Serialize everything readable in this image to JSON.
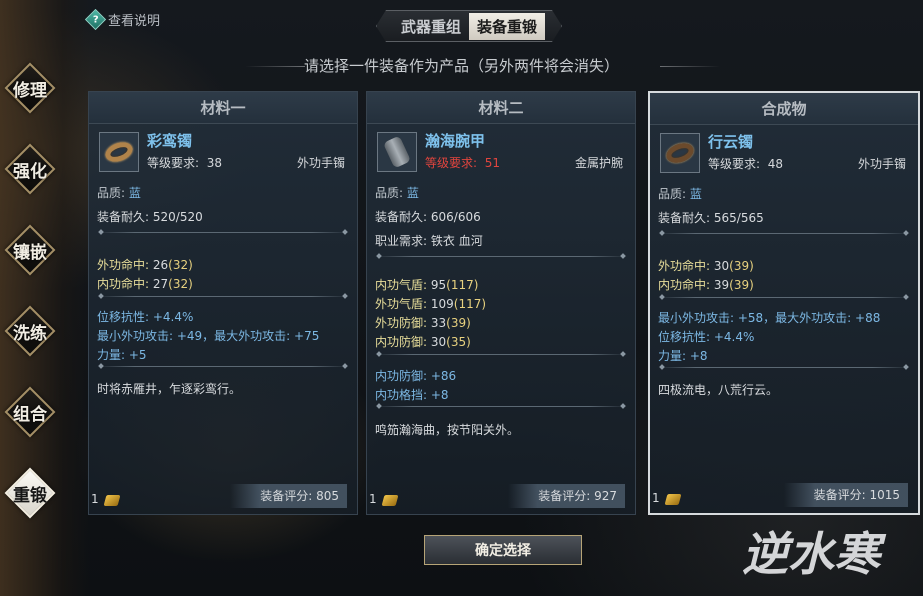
{
  "help": {
    "label": "查看说明",
    "icon": "help-diamond-icon"
  },
  "tabs": [
    {
      "label": "武器重组",
      "active": false
    },
    {
      "label": "装备重锻",
      "active": true
    }
  ],
  "subtitle": "请选择一件装备作为产品（另外两件将会消失）",
  "side_nav": [
    {
      "label": "修理",
      "active": false
    },
    {
      "label": "强化",
      "active": false
    },
    {
      "label": "镶嵌",
      "active": false
    },
    {
      "label": "洗练",
      "active": false
    },
    {
      "label": "组合",
      "active": false
    },
    {
      "label": "重锻",
      "active": true
    }
  ],
  "panels": [
    {
      "header": "材料一",
      "name": "彩鸾镯",
      "level_label": "等级要求:",
      "level": "38",
      "type": "外功手镯",
      "quality_label": "品质:",
      "quality": "蓝",
      "durability_label": "装备耐久:",
      "durability": "520/520",
      "hit_ext_label": "外功命中:",
      "hit_ext": "26",
      "hit_ext_max": "(32)",
      "hit_int_label": "内功命中:",
      "hit_int": "27",
      "hit_int_max": "(32)",
      "bonus": [
        "位移抗性: +4.4%",
        "最小外功攻击: +49，最大外功攻击: +75",
        "力量: +5"
      ],
      "desc": "时将赤雁井，乍逐彩鸾行。",
      "count": "1",
      "score_label": "装备评分:",
      "score": "805"
    },
    {
      "header": "材料二",
      "name": "瀚海腕甲",
      "level_label": "等级要求:",
      "level": "51",
      "type": "金属护腕",
      "quality_label": "品质:",
      "quality": "蓝",
      "durability_label": "装备耐久:",
      "durability": "606/606",
      "req_label": "职业需求:",
      "req": "铁衣 血河",
      "stats": [
        {
          "label": "内功气盾:",
          "val": "95",
          "max": "(117)"
        },
        {
          "label": "外功气盾:",
          "val": "109",
          "max": "(117)"
        },
        {
          "label": "外功防御:",
          "val": "33",
          "max": "(39)"
        },
        {
          "label": "内功防御:",
          "val": "30",
          "max": "(35)"
        }
      ],
      "bonus": [
        "内功防御: +86",
        "内功格挡: +8"
      ],
      "desc": "鸣笳瀚海曲，按节阳关外。",
      "count": "1",
      "score_label": "装备评分:",
      "score": "927"
    },
    {
      "header": "合成物",
      "name": "行云镯",
      "level_label": "等级要求:",
      "level": "48",
      "type": "外功手镯",
      "quality_label": "品质:",
      "quality": "蓝",
      "durability_label": "装备耐久:",
      "durability": "565/565",
      "hit_ext_label": "外功命中:",
      "hit_ext": "30",
      "hit_ext_max": "(39)",
      "hit_int_label": "内功命中:",
      "hit_int": "39",
      "hit_int_max": "(39)",
      "bonus": [
        "最小外功攻击: +58，最大外功攻击: +88",
        "位移抗性: +4.4%",
        "力量: +8"
      ],
      "desc": "四极流电，八荒行云。",
      "count": "1",
      "score_label": "装备评分:",
      "score": "1015"
    }
  ],
  "confirm_label": "确定选择",
  "logo_text": "逆水寒",
  "colors": {
    "item_name": "#7ec1ec",
    "stat_yellow": "#e8de9a",
    "bonus_blue": "#7cb8e4",
    "level_red": "#e0453e"
  }
}
